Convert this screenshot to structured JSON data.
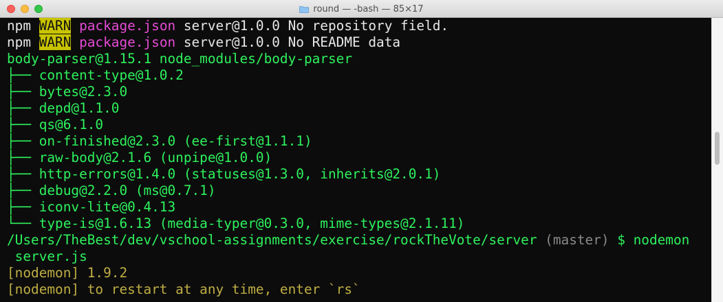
{
  "window": {
    "title": "round — -bash — 85×17",
    "folder_icon": "folder-icon"
  },
  "colors": {
    "green": "#2ef25d",
    "magenta": "#e84bd6",
    "warn_bg": "#c9c400",
    "olive": "#bfae43",
    "background": "#0c0c0c"
  },
  "terminal": {
    "warn1": {
      "prefix": "npm ",
      "tag": "WARN",
      "file": " package.json",
      "rest": " server@1.0.0 No repository field."
    },
    "warn2": {
      "prefix": "npm ",
      "tag": "WARN",
      "file": " package.json",
      "rest": " server@1.0.0 No README data"
    },
    "pkg_line": "body-parser@1.15.1 node_modules/body-parser",
    "deps": [
      "├── content-type@1.0.2",
      "├── bytes@2.3.0",
      "├── depd@1.1.0",
      "├── qs@6.1.0",
      "├── on-finished@2.3.0 (ee-first@1.1.1)",
      "├── raw-body@2.1.6 (unpipe@1.0.0)",
      "├── http-errors@1.4.0 (statuses@1.3.0, inherits@2.0.1)",
      "├── debug@2.2.0 (ms@0.7.1)",
      "├── iconv-lite@0.4.13",
      "└── type-is@1.6.13 (media-typer@0.3.0, mime-types@2.1.11)"
    ],
    "prompt": {
      "path": "/Users/TheBest/dev/vschool-assignments/exercise/rockTheVote/server",
      "branch": " (master)",
      "symbol": " $ ",
      "command": "nodemon",
      "command_cont": " server.js"
    },
    "nodemon1": "[nodemon] 1.9.2",
    "nodemon2": "[nodemon] to restart at any time, enter `rs`"
  }
}
